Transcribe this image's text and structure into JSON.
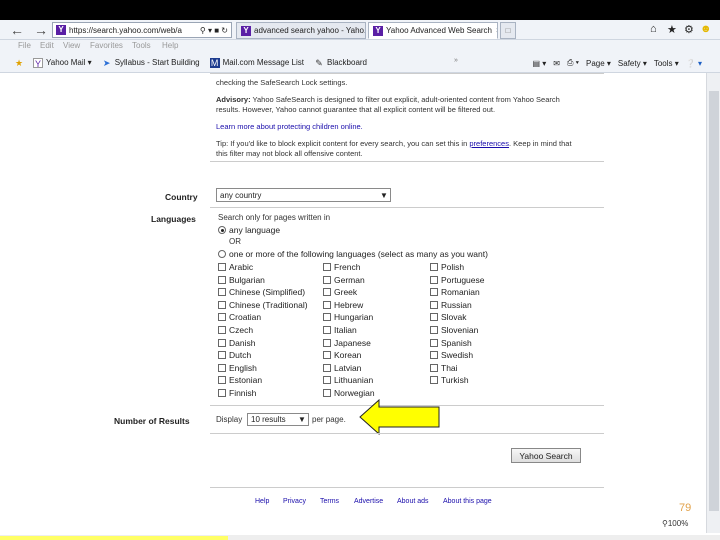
{
  "browser": {
    "address": "https://search.yahoo.com/web/a",
    "tabs": [
      {
        "label": "advanced search yahoo - Yaho..."
      },
      {
        "label": "Yahoo Advanced Web Search"
      }
    ],
    "menu": [
      "File",
      "Edit",
      "View",
      "Favorites",
      "Tools",
      "Help"
    ],
    "favorites": [
      {
        "label": "Yahoo Mail",
        "icon": "yahoo-icon"
      },
      {
        "label": "Syllabus - Start Building",
        "icon": "syllabus-icon"
      },
      {
        "label": "Mail.com Message List",
        "icon": "mail-icon"
      },
      {
        "label": "Blackboard",
        "icon": "blackboard-icon"
      }
    ],
    "commands": {
      "page": "Page",
      "safety": "Safety",
      "tools": "Tools"
    }
  },
  "safesearch": {
    "line1": "checking the SafeSearch Lock settings.",
    "advisory_label": "Advisory:",
    "advisory_line1": "Yahoo SafeSearch is designed to filter out explicit, adult-oriented content from Yahoo Search",
    "advisory_line2": "results. However, Yahoo cannot guarantee that all explicit content will be filtered out.",
    "learn_more": "Learn more about protecting children online.",
    "tip_line1a": "Tip: If you'd like to block explicit content for every search, you can set this in",
    "tip_link": "preferences",
    "tip_line1b": ". Keep in mind that",
    "tip_line2": "this filter may not block all offensive content."
  },
  "country": {
    "label": "Country",
    "value": "any country"
  },
  "languages": {
    "label": "Languages",
    "intro": "Search only for pages written in",
    "any": "any language",
    "or": "OR",
    "one_or_more": "one or more of the following languages (select as many as you want)",
    "col1": [
      "Arabic",
      "Bulgarian",
      "Chinese (Simplified)",
      "Chinese (Traditional)",
      "Croatian",
      "Czech",
      "Danish",
      "Dutch",
      "English",
      "Estonian",
      "Finnish"
    ],
    "col2": [
      "French",
      "German",
      "Greek",
      "Hebrew",
      "Hungarian",
      "Italian",
      "Japanese",
      "Korean",
      "Latvian",
      "Lithuanian",
      "Norwegian"
    ],
    "col3": [
      "Polish",
      "Portuguese",
      "Romanian",
      "Russian",
      "Slovak",
      "Slovenian",
      "Spanish",
      "Swedish",
      "Thai",
      "Turkish"
    ]
  },
  "results": {
    "label": "Number of Results",
    "display": "Display",
    "value": "10 results",
    "suffix": "per page."
  },
  "search_button": "Yahoo Search",
  "footer": [
    "Help",
    "Privacy",
    "Terms",
    "Advertise",
    "About ads",
    "About this page"
  ],
  "slide_number": "79",
  "zoom": "100%",
  "arrow_color": "#ffff00"
}
